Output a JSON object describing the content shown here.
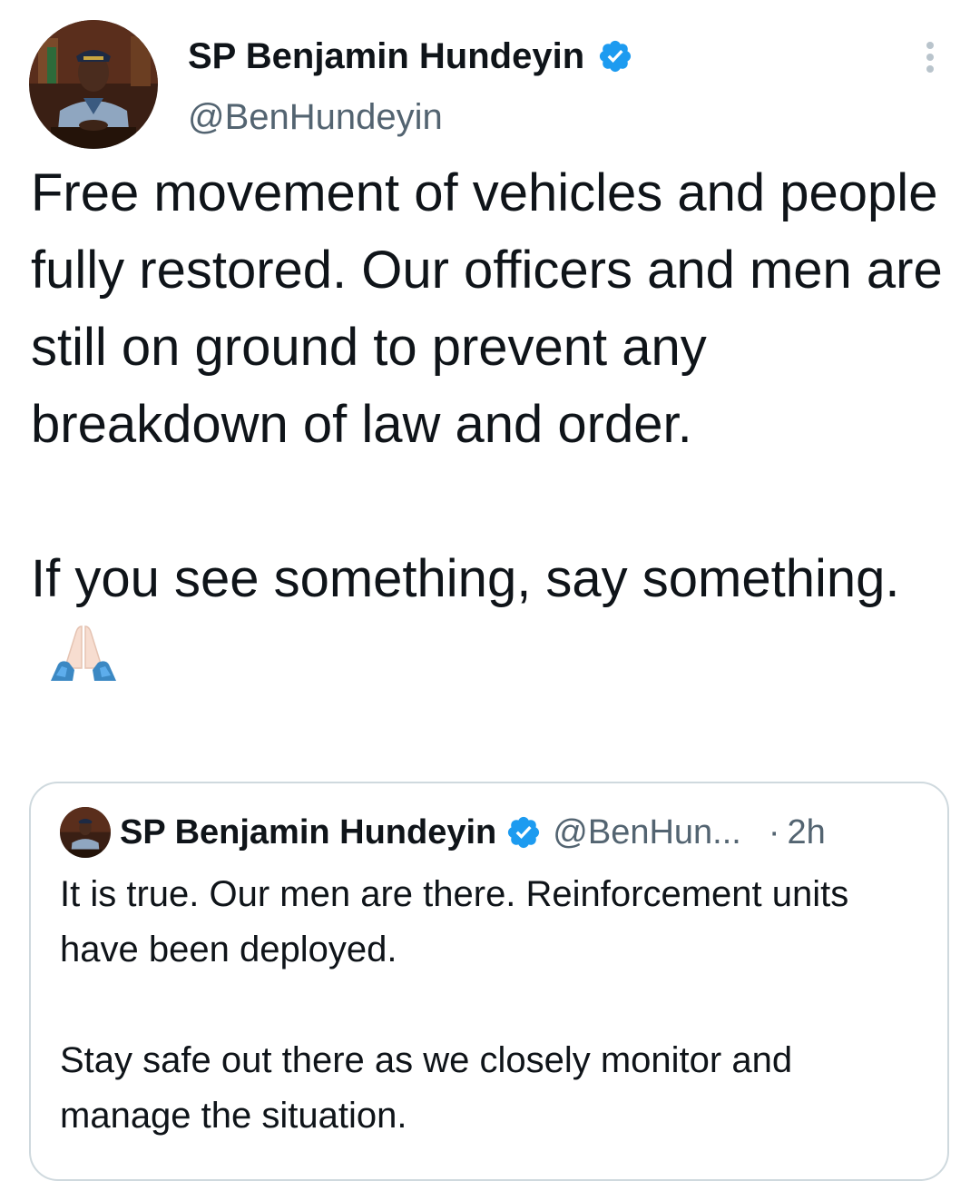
{
  "author": {
    "display_name": "SP Benjamin Hundeyin",
    "handle": "@BenHundeyin",
    "avatar_icon": "profile-photo",
    "verified_icon": "verified-badge-icon",
    "more_icon": "more-options-icon"
  },
  "tweet": {
    "paragraph_1": "Free movement of vehicles and people fully restored. Our officers and men are still on ground to prevent any breakdown of law and order.",
    "paragraph_2": "If you see something, say something.",
    "emoji_icon": "folded-hands-icon"
  },
  "quoted_tweet": {
    "display_name": "SP Benjamin Hundeyin",
    "handle": "@BenHun...",
    "separator": "·",
    "time": "2h",
    "paragraph_1": "It is true. Our men are there. Reinforcement units have been deployed.",
    "paragraph_2": "Stay safe out there as we closely monitor and manage the situation."
  },
  "colors": {
    "text": "#0f1419",
    "secondary_text": "#536471",
    "verified_blue": "#1d9bf0",
    "card_border": "#cfd9de"
  }
}
